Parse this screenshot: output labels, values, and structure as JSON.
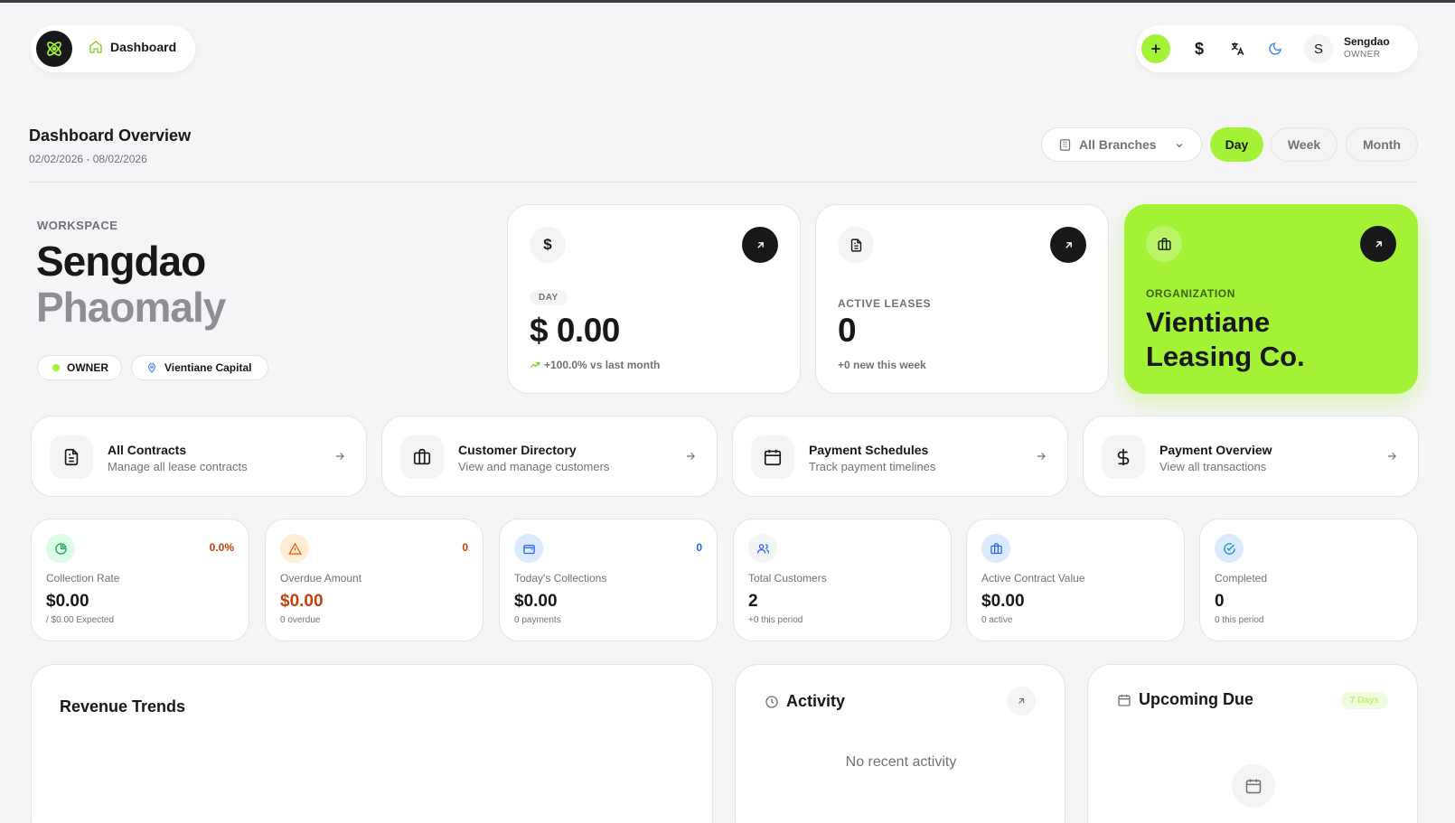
{
  "nav": {
    "title": "Dashboard"
  },
  "topbar": {
    "user_initial": "S",
    "user_name": "Sengdao",
    "user_role": "OWNER",
    "currency_symbol": "$"
  },
  "header": {
    "title": "Dashboard Overview",
    "date_range": "02/02/2026 - 08/02/2026",
    "branch_select": "All Branches",
    "periods": [
      "Day",
      "Week",
      "Month"
    ],
    "active_period": "Day"
  },
  "workspace": {
    "label": "WORKSPACE",
    "first_name": "Sengdao",
    "last_name": "Phaomaly",
    "role_badge": "OWNER",
    "location_badge": "Vientiane Capital"
  },
  "kpis": {
    "revenue": {
      "icon_symbol": "$",
      "period_badge": "DAY",
      "value": "$ 0.00",
      "trend": "+100.0% vs last month"
    },
    "leases": {
      "label": "ACTIVE LEASES",
      "value": "0",
      "sub": "+0 new this week"
    },
    "organization": {
      "label": "ORGANIZATION",
      "name_line1": "Vientiane",
      "name_line2": "Leasing Co."
    }
  },
  "quick_links": [
    {
      "title": "All Contracts",
      "subtitle": "Manage all lease contracts"
    },
    {
      "title": "Customer Directory",
      "subtitle": "View and manage customers"
    },
    {
      "title": "Payment Schedules",
      "subtitle": "Track payment timelines"
    },
    {
      "title": "Payment Overview",
      "subtitle": "View all transactions"
    }
  ],
  "stats": [
    {
      "label": "Collection Rate",
      "value": "$0.00",
      "sub": "/ $0.00 Expected",
      "badge": "0.0%"
    },
    {
      "label": "Overdue Amount",
      "value": "$0.00",
      "sub": "0 overdue",
      "badge": "0"
    },
    {
      "label": "Today's Collections",
      "value": "$0.00",
      "sub": "0 payments",
      "badge": "0"
    },
    {
      "label": "Total Customers",
      "value": "2",
      "sub": "+0 this period"
    },
    {
      "label": "Active Contract Value",
      "value": "$0.00",
      "sub": "0 active"
    },
    {
      "label": "Completed",
      "value": "0",
      "sub": "0 this period"
    }
  ],
  "panels": {
    "revenue_title": "Revenue Trends",
    "activity_title": "Activity",
    "activity_empty": "No recent activity",
    "upcoming_title": "Upcoming Due",
    "upcoming_badge": "7 Days"
  },
  "colors": {
    "accent": "#a3f235",
    "dark": "#18181b",
    "warning": "#c2410c",
    "info": "#2563eb"
  }
}
